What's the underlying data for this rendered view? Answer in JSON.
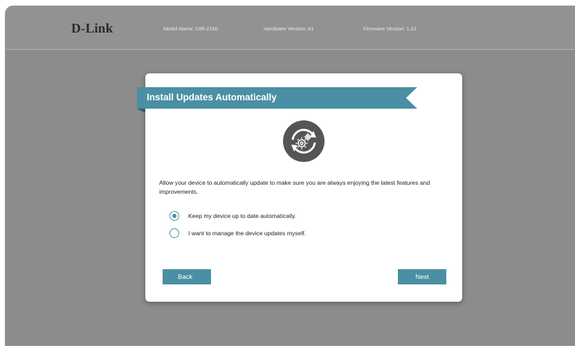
{
  "header": {
    "logo": "D-Link",
    "model": "Model Name: DIR-2150",
    "hardware": "Hardware Version: A1",
    "firmware": "Firmware Version: 1.01"
  },
  "modal": {
    "title": "Install Updates Automatically",
    "icon": "gear-refresh-icon",
    "description": "Allow your device to automatically update to make sure you are always enjoying the latest features and improvements.",
    "options": [
      {
        "label": "Keep my device up to date automatically.",
        "selected": true
      },
      {
        "label": "I want to manage the device updates myself.",
        "selected": false
      }
    ],
    "back_label": "Back",
    "next_label": "Next"
  },
  "colors": {
    "accent": "#4a8fa3",
    "backdrop": "#8c8c8c",
    "header_bar": "#929292",
    "icon_dark": "#555555"
  }
}
